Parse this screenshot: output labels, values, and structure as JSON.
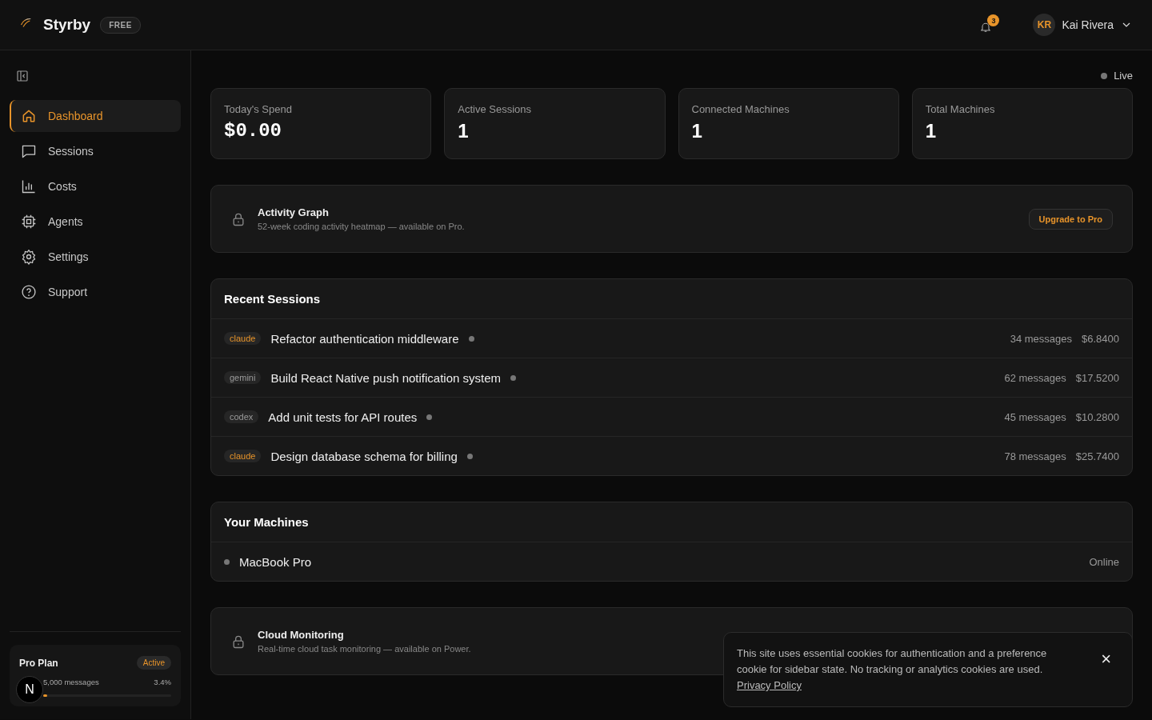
{
  "header": {
    "brand": "Styrby",
    "plan_badge": "FREE",
    "notifications": "3",
    "user": {
      "initials": "KR",
      "name": "Kai Rivera"
    }
  },
  "sidebar": {
    "items": [
      {
        "label": "Dashboard",
        "kind": "home",
        "selected": true
      },
      {
        "label": "Sessions",
        "kind": "chat",
        "selected": false
      },
      {
        "label": "Costs",
        "kind": "chart",
        "selected": false
      },
      {
        "label": "Agents",
        "kind": "chip",
        "selected": false
      },
      {
        "label": "Settings",
        "kind": "gear",
        "selected": false
      },
      {
        "label": "Support",
        "kind": "help",
        "selected": false
      }
    ],
    "plan": {
      "name": "Pro Plan",
      "status": "Active",
      "usage": "5,000 messages",
      "percent": "3.4%",
      "level": 0.034
    },
    "dev_button": "N"
  },
  "status": "Live",
  "stats": [
    {
      "label": "Today's Spend",
      "value": "$0.00",
      "kind": "money"
    },
    {
      "label": "Active Sessions",
      "value": "1",
      "kind": "count"
    },
    {
      "label": "Connected Machines",
      "value": "1",
      "kind": "count"
    },
    {
      "label": "Total Machines",
      "value": "1",
      "kind": "count"
    }
  ],
  "activity_graph": {
    "title": "Activity Graph",
    "description": "52-week coding activity heatmap — available on Pro.",
    "button": "Upgrade to Pro"
  },
  "recent_sessions": {
    "title": "Recent Sessions",
    "rows": [
      {
        "agent": "claude",
        "color": "#e8942a",
        "title": "Refactor authentication middleware",
        "messages": "34 messages",
        "cost": "$6.8400"
      },
      {
        "agent": "gemini",
        "color": "#9a9a9a",
        "title": "Build React Native push notification system",
        "messages": "62 messages",
        "cost": "$17.5200"
      },
      {
        "agent": "codex",
        "color": "#9a9a9a",
        "title": "Add unit tests for API routes",
        "messages": "45 messages",
        "cost": "$10.2800"
      },
      {
        "agent": "claude",
        "color": "#e8942a",
        "title": "Design database schema for billing",
        "messages": "78 messages",
        "cost": "$25.7400"
      }
    ]
  },
  "machines": {
    "title": "Your Machines",
    "rows": [
      {
        "name": "MacBook Pro",
        "status": "Online"
      }
    ]
  },
  "cloud_monitoring": {
    "title": "Cloud Monitoring",
    "description": "Real-time cloud task monitoring — available on Power."
  },
  "cookie_banner": {
    "text": "This site uses essential cookies for authentication and a preference cookie for sidebar state. No tracking or analytics cookies are used.",
    "link": "Privacy Policy",
    "close": "×"
  }
}
